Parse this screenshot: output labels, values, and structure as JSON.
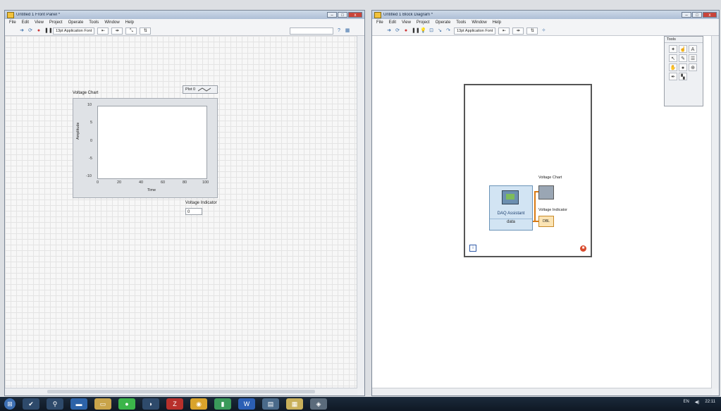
{
  "left_window": {
    "title": "Untitled 1 Front Panel *",
    "menu": [
      "File",
      "Edit",
      "View",
      "Project",
      "Operate",
      "Tools",
      "Window",
      "Help"
    ],
    "font_selector": "13pt Application Font",
    "chart": {
      "label": "Voltage Chart",
      "legend_plot": "Plot 0",
      "y_axis_title": "Amplitude",
      "x_axis_title": "Time",
      "y_ticks": [
        "10",
        "5",
        "0",
        "-5",
        "-10"
      ],
      "x_ticks": [
        "0",
        "20",
        "40",
        "60",
        "80",
        "100"
      ]
    },
    "indicator": {
      "label": "Voltage Indicator",
      "value": "0"
    }
  },
  "right_window": {
    "title": "Untitled 1 Block Diagram *",
    "menu": [
      "File",
      "Edit",
      "View",
      "Project",
      "Operate",
      "Tools",
      "Window",
      "Help"
    ],
    "font_selector": "13pt Application Font",
    "tools_palette": {
      "title": "Tools"
    },
    "daq": {
      "name": "DAQ Assistant",
      "output": "data"
    },
    "chart_terminal_label": "Voltage Chart",
    "indicator_terminal": {
      "label": "Voltage Indicator",
      "type": "DBL"
    },
    "loop_iteration": "i"
  },
  "tray": {
    "lang": "EN",
    "time": "22:11"
  },
  "window_buttons": {
    "minimize": "–",
    "maximize": "□",
    "close": "x"
  }
}
